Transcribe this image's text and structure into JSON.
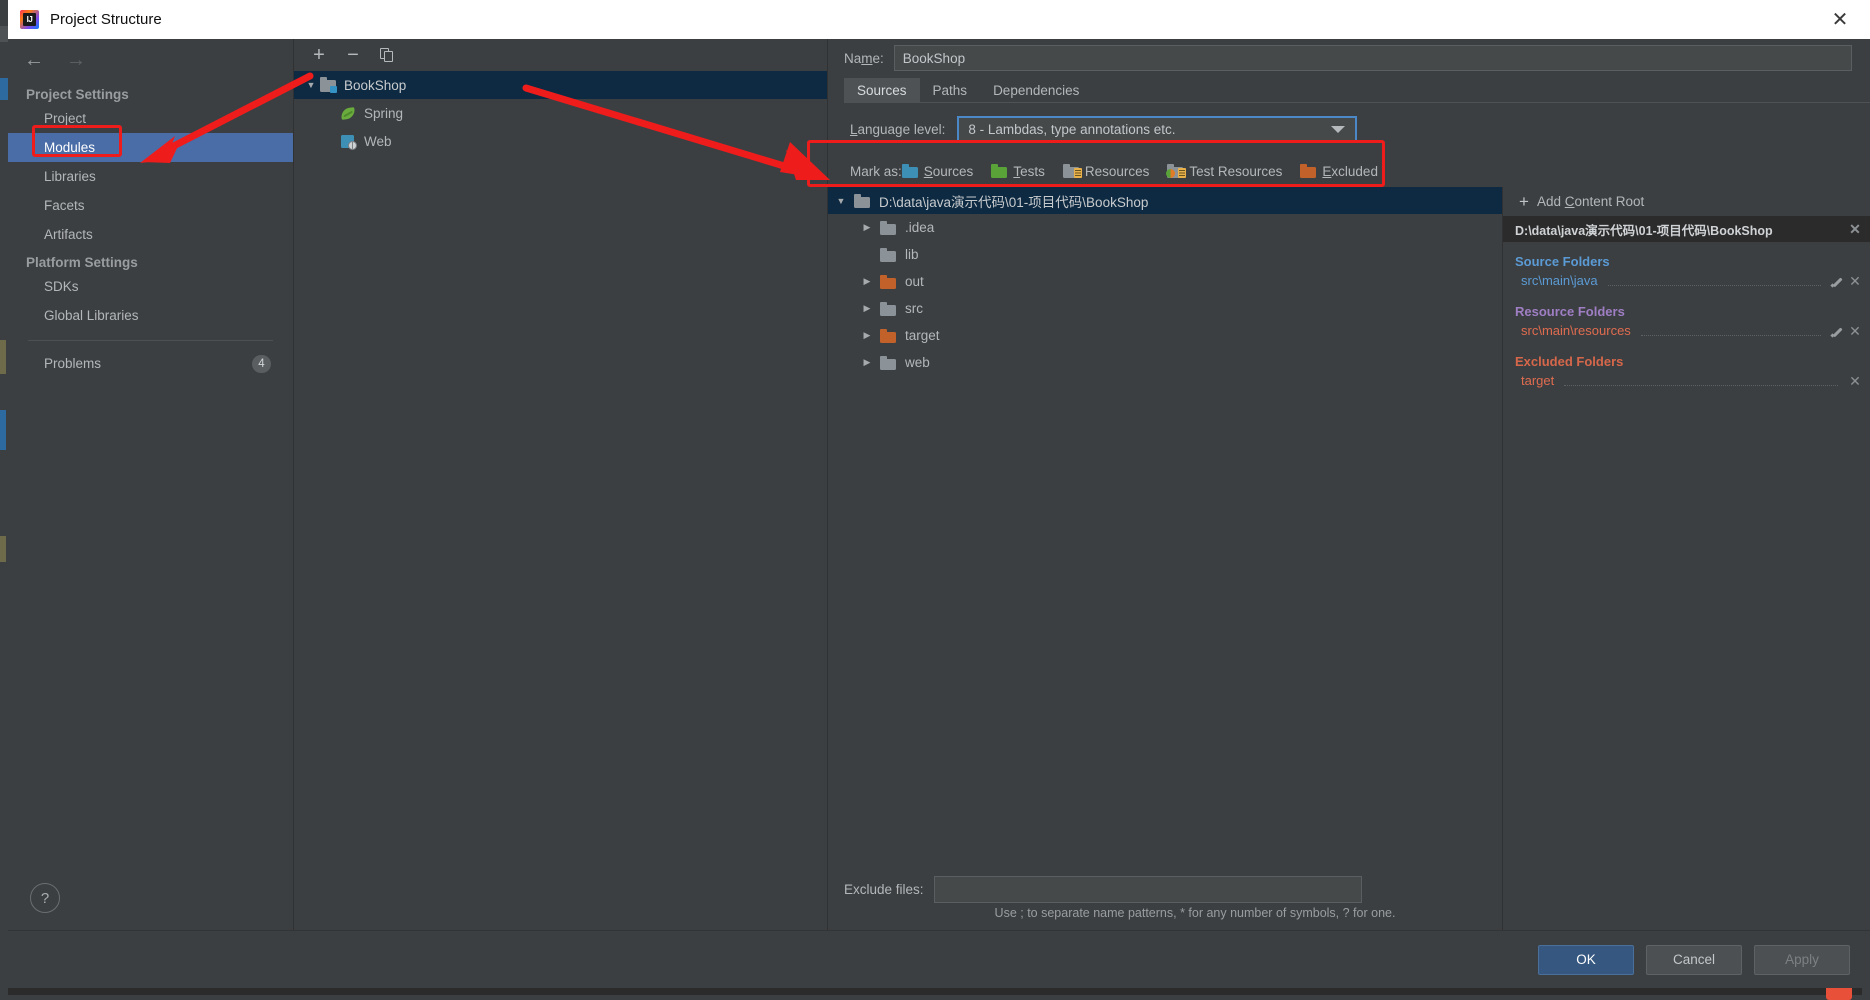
{
  "window": {
    "title": "Project Structure",
    "logo_text": "IJ",
    "close_label": "✕"
  },
  "nav": {
    "back_icon": "←",
    "forward_icon": "→"
  },
  "sidebar": {
    "groups": [
      {
        "title": "Project Settings",
        "items": [
          {
            "label": "Project",
            "selected": false
          },
          {
            "label": "Modules",
            "selected": true
          },
          {
            "label": "Libraries",
            "selected": false
          },
          {
            "label": "Facets",
            "selected": false
          },
          {
            "label": "Artifacts",
            "selected": false
          }
        ]
      },
      {
        "title": "Platform Settings",
        "items": [
          {
            "label": "SDKs",
            "selected": false
          },
          {
            "label": "Global Libraries",
            "selected": false
          }
        ]
      }
    ],
    "problems": {
      "label": "Problems",
      "count": "4"
    },
    "help_label": "?"
  },
  "modules": {
    "toolbar": {
      "add": "+",
      "remove": "−",
      "copy": "copy"
    },
    "tree": [
      {
        "label": "BookShop",
        "icon": "module-icon",
        "indent": 0,
        "expander": "▼",
        "selected": true
      },
      {
        "label": "Spring",
        "icon": "spring-icon",
        "indent": 1,
        "expander": "",
        "selected": false
      },
      {
        "label": "Web",
        "icon": "web-icon",
        "indent": 1,
        "expander": "",
        "selected": false
      }
    ]
  },
  "editor": {
    "name_label": "Name:",
    "name_value": "BookShop",
    "tabs": [
      {
        "label": "Sources",
        "active": true
      },
      {
        "label": "Paths",
        "active": false
      },
      {
        "label": "Dependencies",
        "active": false
      }
    ],
    "language_level": {
      "label": "Language level:",
      "value": "8 - Lambdas, type annotations etc."
    },
    "mark_as": {
      "label": "Mark as:",
      "options": [
        {
          "label": "Sources",
          "color": "blue"
        },
        {
          "label": "Tests",
          "color": "green"
        },
        {
          "label": "Resources",
          "color": "gray"
        },
        {
          "label": "Test Resources",
          "color": "gray"
        },
        {
          "label": "Excluded",
          "color": "orange"
        }
      ]
    },
    "file_tree": [
      {
        "label": "D:\\data\\java演示代码\\01-项目代码\\BookShop",
        "indent": 0,
        "expander": "▼",
        "color": "gray",
        "selected": true
      },
      {
        "label": ".idea",
        "indent": 1,
        "expander": "▶",
        "color": "gray",
        "selected": false
      },
      {
        "label": "lib",
        "indent": 1,
        "expander": "",
        "color": "gray",
        "selected": false
      },
      {
        "label": "out",
        "indent": 1,
        "expander": "▶",
        "color": "orange",
        "selected": false
      },
      {
        "label": "src",
        "indent": 1,
        "expander": "▶",
        "color": "gray",
        "selected": false
      },
      {
        "label": "target",
        "indent": 1,
        "expander": "▶",
        "color": "orange",
        "selected": false
      },
      {
        "label": "web",
        "indent": 1,
        "expander": "▶",
        "color": "gray",
        "selected": false
      }
    ],
    "exclude": {
      "label": "Exclude files:",
      "value": "",
      "hint": "Use ; to separate name patterns, * for any number of symbols, ? for one."
    }
  },
  "content_roots": {
    "add_label": "Add Content Root",
    "root_path": "D:\\data\\java演示代码\\01-项目代码\\BookShop",
    "sections": [
      {
        "title": "Source Folders",
        "kind": "src",
        "entries": [
          {
            "path": "src\\main\\java",
            "editable": true
          }
        ]
      },
      {
        "title": "Resource Folders",
        "kind": "res",
        "entries": [
          {
            "path": "src\\main\\resources",
            "editable": true
          }
        ]
      },
      {
        "title": "Excluded Folders",
        "kind": "exc",
        "entries": [
          {
            "path": "target",
            "editable": false
          }
        ]
      }
    ],
    "remove_icon": "✕"
  },
  "buttons": {
    "ok": "OK",
    "cancel": "Cancel",
    "apply": "Apply"
  },
  "annotations": {
    "color": "#ef1c1c",
    "boxes": [
      "modules-highlight",
      "language-level-highlight"
    ],
    "arrows": [
      "arrow-to-modules",
      "arrow-to-language-level"
    ]
  },
  "colors": {
    "accent_selection": "#4a6da7",
    "tree_selection": "#0d2a42",
    "combo_focus": "#4a88c7",
    "annotation_red": "#ef1c1c",
    "ok_button": "#365880",
    "source_folder": "#5b9bd5",
    "resource_folder": "#9f7ec4",
    "excluded_folder": "#d6674a",
    "dialog_bg": "#3c3f41"
  }
}
